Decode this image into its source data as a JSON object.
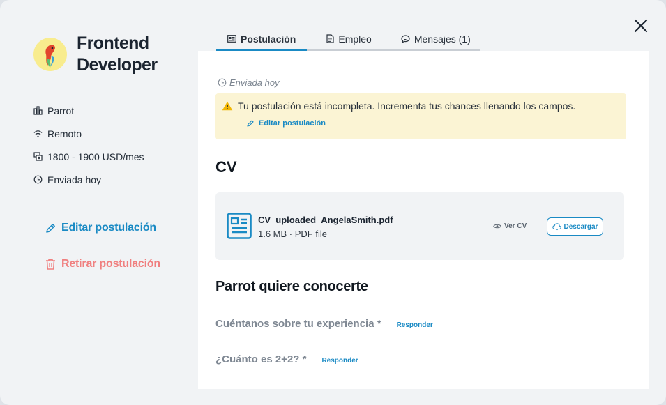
{
  "job": {
    "title": "Frontend Developer",
    "company": "Parrot",
    "location": "Remoto",
    "salary": "1800 - 1900 USD/mes",
    "status": "Enviada hoy"
  },
  "sidebar": {
    "edit_label": "Editar postulación",
    "withdraw_label": "Retirar postulación"
  },
  "tabs": [
    {
      "label": "Postulación",
      "icon": "id-card-icon"
    },
    {
      "label": "Empleo",
      "icon": "document-icon"
    },
    {
      "label": "Mensajes (1)",
      "icon": "chat-icon"
    }
  ],
  "main": {
    "sent_label": "Enviada hoy",
    "alert_text": "Tu postulación está incompleta. Incrementa tus chances llenando los campos.",
    "alert_link": "Editar postulación",
    "cv_heading": "CV",
    "cv_file": {
      "name": "CV_uploaded_AngelaSmith.pdf",
      "meta": "1.6 MB · PDF file",
      "view_label": "Ver CV",
      "download_label": "Descargar"
    },
    "questions_heading": "Parrot quiere conocerte",
    "questions": [
      {
        "text": "Cuéntanos sobre tu experiencia *",
        "action": "Responder"
      },
      {
        "text": "¿Cuánto es 2+2? *",
        "action": "Responder"
      }
    ]
  },
  "colors": {
    "accent": "#1a8ac4",
    "danger": "#f07f7f",
    "alert_bg": "#fbf4d4",
    "warning": "#f2b705"
  }
}
